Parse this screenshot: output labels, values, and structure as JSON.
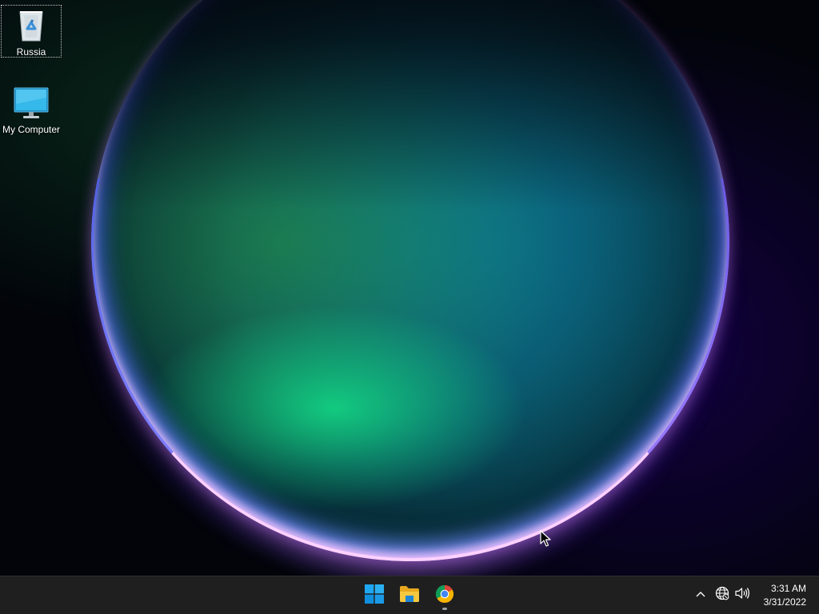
{
  "desktop": {
    "icons": [
      {
        "label": "Russia",
        "icon": "recycle-bin-icon"
      },
      {
        "label": "My Computer",
        "icon": "computer-monitor-icon"
      }
    ]
  },
  "taskbar": {
    "pinned": [
      {
        "name": "Start",
        "icon": "windows-logo-icon"
      },
      {
        "name": "File Explorer",
        "icon": "folder-icon"
      },
      {
        "name": "Google Chrome",
        "icon": "chrome-icon",
        "running": true
      }
    ],
    "tray": {
      "icons": [
        "chevron-up-icon",
        "network-globe-icon",
        "volume-icon"
      ]
    },
    "clock": {
      "time": "3:31 AM",
      "date": "3/31/2022"
    }
  },
  "colors": {
    "taskbar_bg": "#1f1f1f",
    "windows_blue": "#0078d4",
    "folder_yellow": "#f3c33b"
  }
}
